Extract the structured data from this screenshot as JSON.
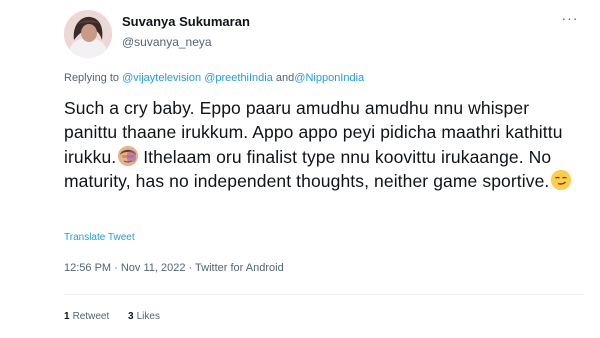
{
  "tweet": {
    "author_name": "Suvanya Sukumaran",
    "author_handle": "@suvanya_neya",
    "replying_prefix": "Replying to",
    "mentions": [
      "@vijaytelevision",
      "@preethiIndia",
      "@NipponIndia"
    ],
    "mention_joiner": "and",
    "body_text_1": "Such a cry baby. Eppo paaru amudhu amudhu nnu whisper panittu thaane irukkum. Appo appo peyi pidicha maathri kathittu irukku.",
    "body_text_2": " Ithelaam oru finalist type nnu koovittu irukaange. No maturity, has no independent thoughts, neither game sportive.",
    "emoji_1": "face-palm-emoji",
    "emoji_2": "smirk-emoji",
    "translate_label": "Translate Tweet",
    "timestamp": "12:56 PM · Nov 11, 2022 · Twitter for Android",
    "retweets_count": "1",
    "retweets_label": "Retweet",
    "likes_count": "3",
    "likes_label": "Likes"
  }
}
